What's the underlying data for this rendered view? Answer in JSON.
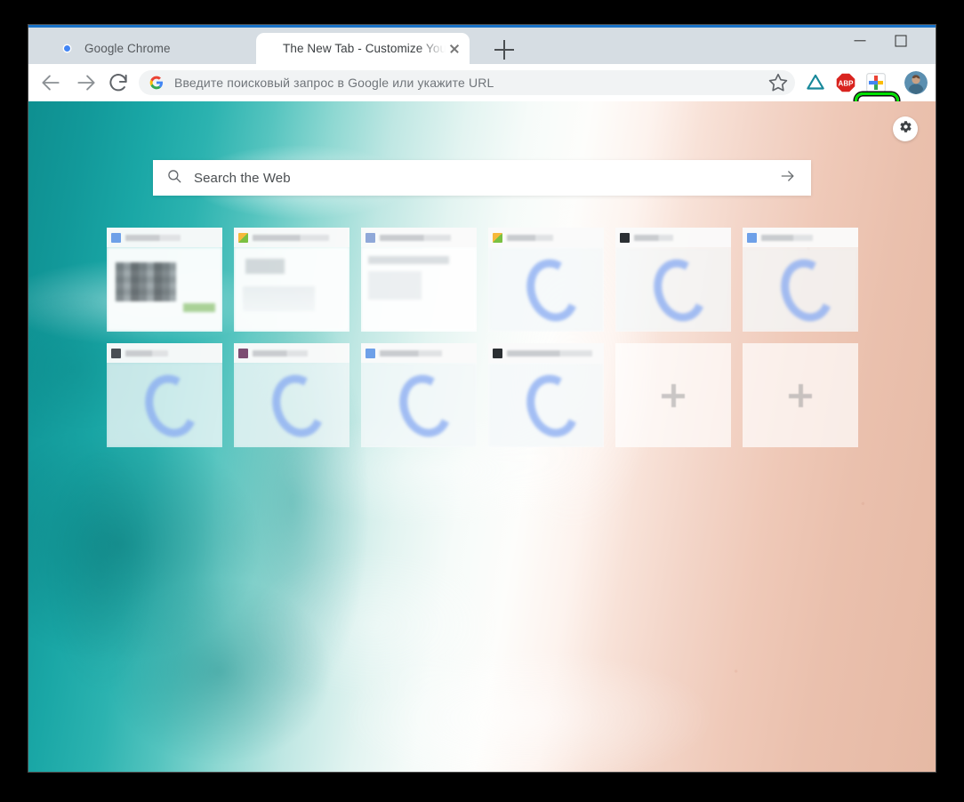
{
  "window": {
    "controls": {
      "minimize": "minimize-button",
      "maximize": "maximize-button",
      "close": "close-button"
    }
  },
  "tabs": [
    {
      "title": "Google Chrome",
      "favicon": "chrome-logo-icon",
      "active": false
    },
    {
      "title": "The New Tab - Customize Your Start P",
      "favicon": "none",
      "active": true
    }
  ],
  "new_tab_button": {
    "icon": "plus-icon",
    "label": "+"
  },
  "toolbar": {
    "back": "back-arrow-icon",
    "forward": "forward-arrow-icon",
    "reload": "reload-icon",
    "omnibox": {
      "icon": "google-g-icon",
      "placeholder": "Введите поисковый запрос в Google или укажите URL",
      "value": ""
    },
    "bookmark_star": "star-icon",
    "extensions": [
      {
        "name": "triangle-extension-icon",
        "label": "",
        "color": "#17889a"
      },
      {
        "name": "adblock-plus-icon",
        "label": "ABP",
        "color": "#d9241f"
      },
      {
        "name": "new-tab-extension-icon",
        "label": "+",
        "highlighted": true,
        "highlight_color": "#00e000"
      }
    ],
    "profile_avatar": "profile-avatar",
    "menu": "three-dot-menu-icon"
  },
  "page": {
    "settings_button": {
      "icon": "gear-icon"
    },
    "search": {
      "icon": "search-icon",
      "placeholder": "Search the Web",
      "value": "",
      "submit_icon": "arrow-right-icon"
    },
    "tiles": [
      {
        "title": "",
        "preview": "p-doc",
        "favicon": "fav-b",
        "name_width": 62,
        "add": false
      },
      {
        "title": "",
        "preview": "p-card",
        "favicon": "fav-o",
        "name_width": 86,
        "add": false
      },
      {
        "title": "",
        "preview": "p-web",
        "favicon": "fav-g",
        "name_width": 80,
        "add": false
      },
      {
        "title": "",
        "preview": "p-blue",
        "favicon": "fav-o",
        "name_width": 52,
        "add": false
      },
      {
        "title": "",
        "preview": "p-blue",
        "favicon": "fav-k",
        "name_width": 44,
        "add": false
      },
      {
        "title": "",
        "preview": "p-blue",
        "favicon": "fav-b",
        "name_width": 58,
        "add": false
      },
      {
        "title": "",
        "preview": "p-blue",
        "favicon": "fav-d",
        "name_width": 48,
        "add": false
      },
      {
        "title": "",
        "preview": "p-blue",
        "favicon": "fav-p",
        "name_width": 62,
        "add": false
      },
      {
        "title": "",
        "preview": "p-blue",
        "favicon": "fav-b",
        "name_width": 70,
        "add": false
      },
      {
        "title": "",
        "preview": "p-blue",
        "favicon": "fav-k",
        "name_width": 96,
        "add": false
      },
      {
        "title": "",
        "preview": "",
        "favicon": "",
        "name_width": 0,
        "add": true,
        "add_icon": "plus-icon"
      },
      {
        "title": "",
        "preview": "",
        "favicon": "",
        "name_width": 0,
        "add": true,
        "add_icon": "plus-icon"
      }
    ],
    "background": {
      "name": "aerial-beach-photo",
      "ocean_color": "#12999a",
      "foam_color": "#ffffff",
      "sand_color": "#e9bda9"
    }
  },
  "colors": {
    "titlebar": "#d6dde3",
    "accent_top": "#1a73c8",
    "toolbar": "#ffffff",
    "omnibox": "#f1f3f4",
    "highlight": "#00e000",
    "frame": "#000000"
  }
}
